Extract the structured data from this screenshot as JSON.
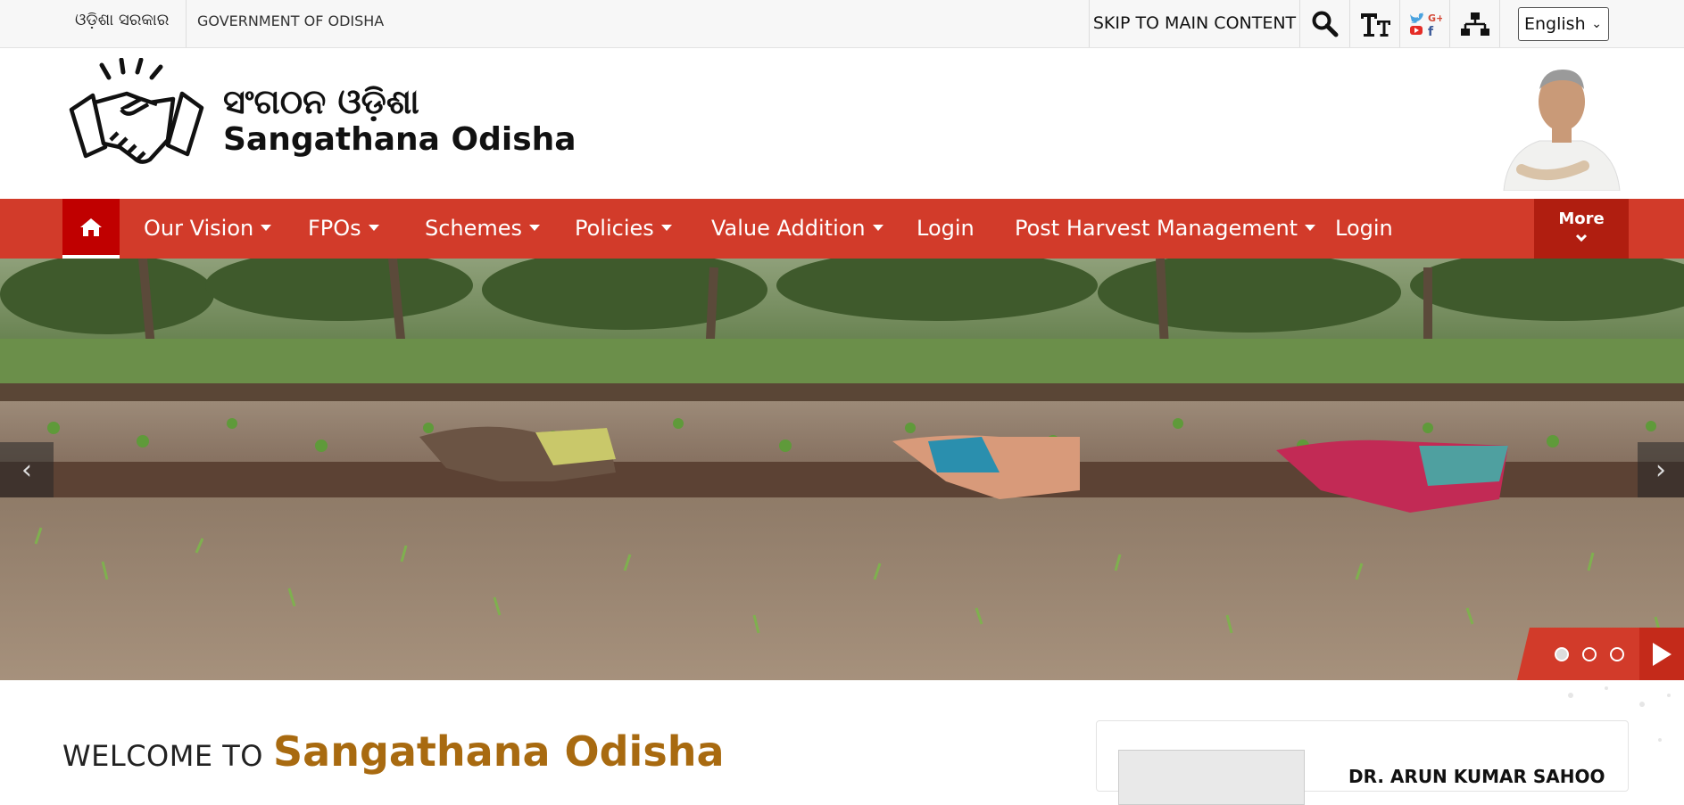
{
  "topbar": {
    "gov_odia": "ଓଡ଼ିଶା ସରକାର",
    "gov_en": "GOVERNMENT OF ODISHA",
    "skip_link": "SKIP TO MAIN CONTENT",
    "icons": [
      "search-icon",
      "text-size-icon",
      "social-media-icon",
      "sitemap-icon"
    ],
    "language": "English"
  },
  "header": {
    "brand_odia": "ସଂଗଠନ ଓଡ଼ିଶା",
    "brand_en": "Sangathana Odisha"
  },
  "nav": {
    "items": [
      {
        "label": "Our Vision",
        "dropdown": true
      },
      {
        "label": "FPOs",
        "dropdown": true
      },
      {
        "label": "Schemes",
        "dropdown": true
      },
      {
        "label": "Policies",
        "dropdown": true
      },
      {
        "label": "Value Addition",
        "dropdown": true
      },
      {
        "label": "Login",
        "dropdown": false
      },
      {
        "label": "Post Harvest Management",
        "dropdown": true
      },
      {
        "label": "Login",
        "dropdown": false
      }
    ],
    "more_label": "More"
  },
  "slider": {
    "slide_count": 3,
    "active_slide": 1
  },
  "welcome": {
    "prefix": "WELCOME TO",
    "name": "Sangathana Odisha"
  },
  "side_card": {
    "name": "DR. ARUN KUMAR SAHOO"
  },
  "colors": {
    "nav_red": "#d23b2a",
    "home_red": "#c00000",
    "brand_gold": "#a86a10"
  }
}
